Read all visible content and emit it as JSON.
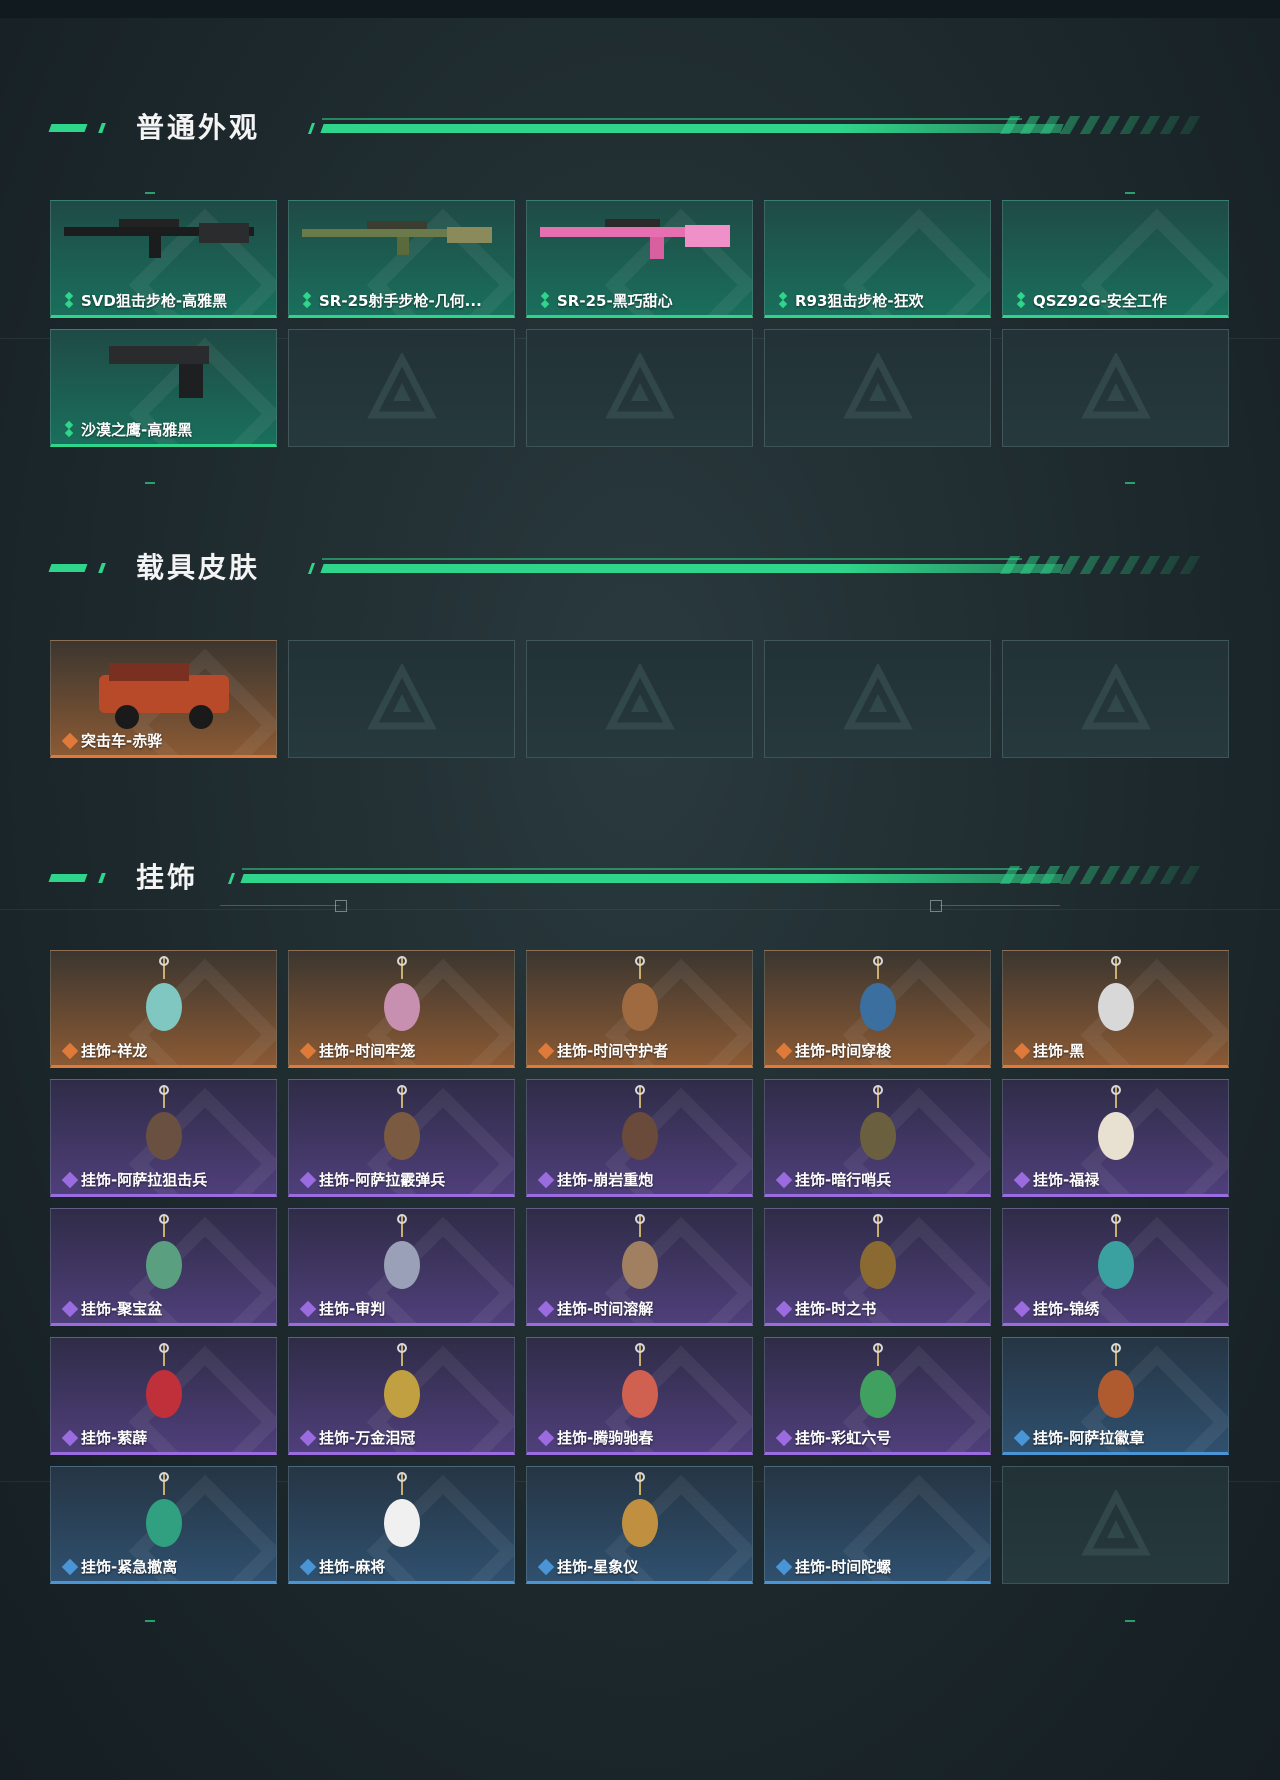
{
  "colors": {
    "accent": "#2fd58a",
    "rarity_green": "#2fd58a",
    "rarity_orange": "#e07a3a",
    "rarity_purple": "#9b6be0",
    "rarity_blue": "#4a95d6"
  },
  "sections": {
    "weapons": {
      "title": "普通外观",
      "items": [
        {
          "label": "SVD狙击步枪-高雅黑",
          "rarity": "green",
          "icon": "sniper-rifle-icon"
        },
        {
          "label": "SR-25射手步枪-几何...",
          "rarity": "green",
          "icon": "camo-rifle-icon"
        },
        {
          "label": "SR-25-黑巧甜心",
          "rarity": "green",
          "icon": "pink-rifle-icon"
        },
        {
          "label": "R93狙击步枪-狂欢",
          "rarity": "green",
          "icon": ""
        },
        {
          "label": "QSZ92G-安全工作",
          "rarity": "green",
          "icon": ""
        },
        {
          "label": "沙漠之鹰-高雅黑",
          "rarity": "green",
          "icon": "pistol-icon"
        }
      ]
    },
    "vehicles": {
      "title": "载具皮肤",
      "items": [
        {
          "label": "突击车-赤骅",
          "rarity": "orange",
          "icon": "assault-vehicle-icon"
        }
      ]
    },
    "charms": {
      "title": "挂饰",
      "items": [
        {
          "label": "挂饰-祥龙",
          "rarity": "orange",
          "icon": "dragon-charm-icon"
        },
        {
          "label": "挂饰-时间牢笼",
          "rarity": "orange",
          "icon": "cage-charm-icon"
        },
        {
          "label": "挂饰-时间守护者",
          "rarity": "orange",
          "icon": "guardian-charm-icon"
        },
        {
          "label": "挂饰-时间穿梭",
          "rarity": "orange",
          "icon": "shuttle-charm-icon"
        },
        {
          "label": "挂饰-黑",
          "rarity": "orange",
          "icon": "tag-charm-icon"
        },
        {
          "label": "挂饰-阿萨拉狙击兵",
          "rarity": "purple",
          "icon": "sniper-figure-charm-icon"
        },
        {
          "label": "挂饰-阿萨拉霰弹兵",
          "rarity": "purple",
          "icon": "shotgun-figure-charm-icon"
        },
        {
          "label": "挂饰-崩岩重炮",
          "rarity": "purple",
          "icon": "heavy-figure-charm-icon"
        },
        {
          "label": "挂饰-暗行哨兵",
          "rarity": "purple",
          "icon": "sentinel-charm-icon"
        },
        {
          "label": "挂饰-福禄",
          "rarity": "purple",
          "icon": "gourd-charm-icon"
        },
        {
          "label": "挂饰-聚宝盆",
          "rarity": "purple",
          "icon": "treasure-bowl-charm-icon"
        },
        {
          "label": "挂饰-审判",
          "rarity": "purple",
          "icon": "card-charm-icon"
        },
        {
          "label": "挂饰-时间溶解",
          "rarity": "purple",
          "icon": "dissolve-charm-icon"
        },
        {
          "label": "挂饰-时之书",
          "rarity": "purple",
          "icon": "book-charm-icon"
        },
        {
          "label": "挂饰-锦绣",
          "rarity": "purple",
          "icon": "butterfly-charm-icon"
        },
        {
          "label": "挂饰-萦薜",
          "rarity": "purple",
          "icon": "flower-charm-icon"
        },
        {
          "label": "挂饰-万金泪冠",
          "rarity": "purple",
          "icon": "crown-charm-icon"
        },
        {
          "label": "挂饰-腾驹驰春",
          "rarity": "purple",
          "icon": "carriage-charm-icon"
        },
        {
          "label": "挂饰-彩虹六号",
          "rarity": "purple",
          "icon": "six-charm-icon"
        },
        {
          "label": "挂饰-阿萨拉徽章",
          "rarity": "blue",
          "icon": "badge-charm-icon"
        },
        {
          "label": "挂饰-紧急撤离",
          "rarity": "blue",
          "icon": "evac-charm-icon"
        },
        {
          "label": "挂饰-麻将",
          "rarity": "blue",
          "icon": "mahjong-charm-icon"
        },
        {
          "label": "挂饰-星象仪",
          "rarity": "blue",
          "icon": "astrolabe-charm-icon"
        },
        {
          "label": "挂饰-时间陀螺",
          "rarity": "blue",
          "icon": ""
        }
      ]
    }
  }
}
